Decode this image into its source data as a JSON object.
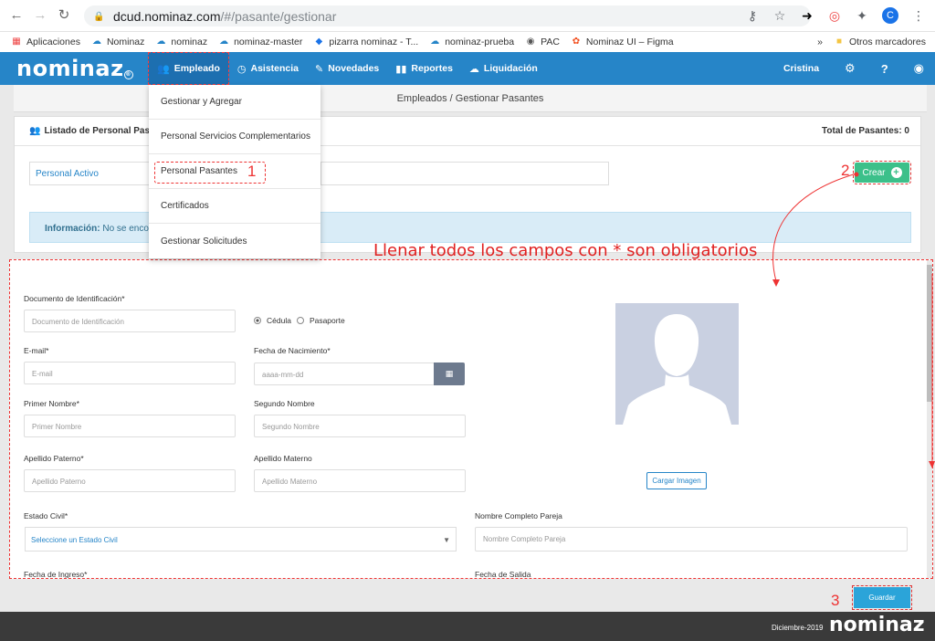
{
  "browser": {
    "url_domain": "dcud.nominaz.com",
    "url_path": "/#/pasante/gestionar",
    "profile_initial": "C",
    "bookmarks": [
      "Aplicaciones",
      "Nominaz",
      "nominaz",
      "nominaz-master",
      "pizarra nominaz - T...",
      "nominaz-prueba",
      "PAC",
      "Nominaz UI – Figma"
    ],
    "bookmarks_more": "»",
    "other_bookmarks": "Otros marcadores"
  },
  "app": {
    "logo": "nominaz",
    "logo_mark": "®",
    "menu": [
      "Empleado",
      "Asistencia",
      "Novedades",
      "Reportes",
      "Liquidación"
    ],
    "user": "Cristina"
  },
  "page": {
    "breadcrumb": "Empleados / Gestionar Pasantes",
    "panel_title": "Listado de Personal Pasan",
    "total_label": "Total de Pasantes: 0",
    "filter_value": "Personal Activo",
    "create_label": "Crear",
    "info_label": "Información:",
    "info_text": "No se encon"
  },
  "dropdown": [
    "Gestionar y Agregar",
    "Personal Servicios Complementarios",
    "Personal Pasantes",
    "Certificados",
    "Gestionar Solicitudes"
  ],
  "annotations": {
    "step1": "1",
    "step2": "2",
    "step3": "3",
    "instruction": "Llenar todos los campos con * son obligatorios"
  },
  "form": {
    "doc_label": "Documento de Identificación*",
    "doc_placeholder": "Documento de Identificación",
    "radio_cedula": "Cédula",
    "radio_pasaporte": "Pasaporte",
    "email_label": "E-mail*",
    "email_placeholder": "E-mail",
    "birth_label": "Fecha de Nacimiento*",
    "birth_placeholder": "aaaa-mm-dd",
    "first_name_label": "Primer Nombre*",
    "first_name_placeholder": "Primer Nombre",
    "second_name_label": "Segundo Nombre",
    "second_name_placeholder": "Segundo Nombre",
    "last_name_p_label": "Apellido Paterno*",
    "last_name_p_placeholder": "Apellido Paterno",
    "last_name_m_label": "Apellido Materno",
    "last_name_m_placeholder": "Apellido Materno",
    "civil_label": "Estado Civil*",
    "civil_value": "Seleccione un Estado Civil",
    "partner_label": "Nombre Completo Pareja",
    "partner_placeholder": "Nombre Completo Pareja",
    "ingreso_label": "Fecha de Ingreso*",
    "salida_label": "Fecha de Salida",
    "upload_label": "Cargar Imagen",
    "save_label": "Guardar"
  },
  "footer": {
    "date": "Diciembre-2019",
    "logo": "nominaz"
  },
  "colors": {
    "primary": "#2685c8",
    "success": "#3cc08a",
    "annotation": "#e33333",
    "footer": "#3a3a3a"
  }
}
